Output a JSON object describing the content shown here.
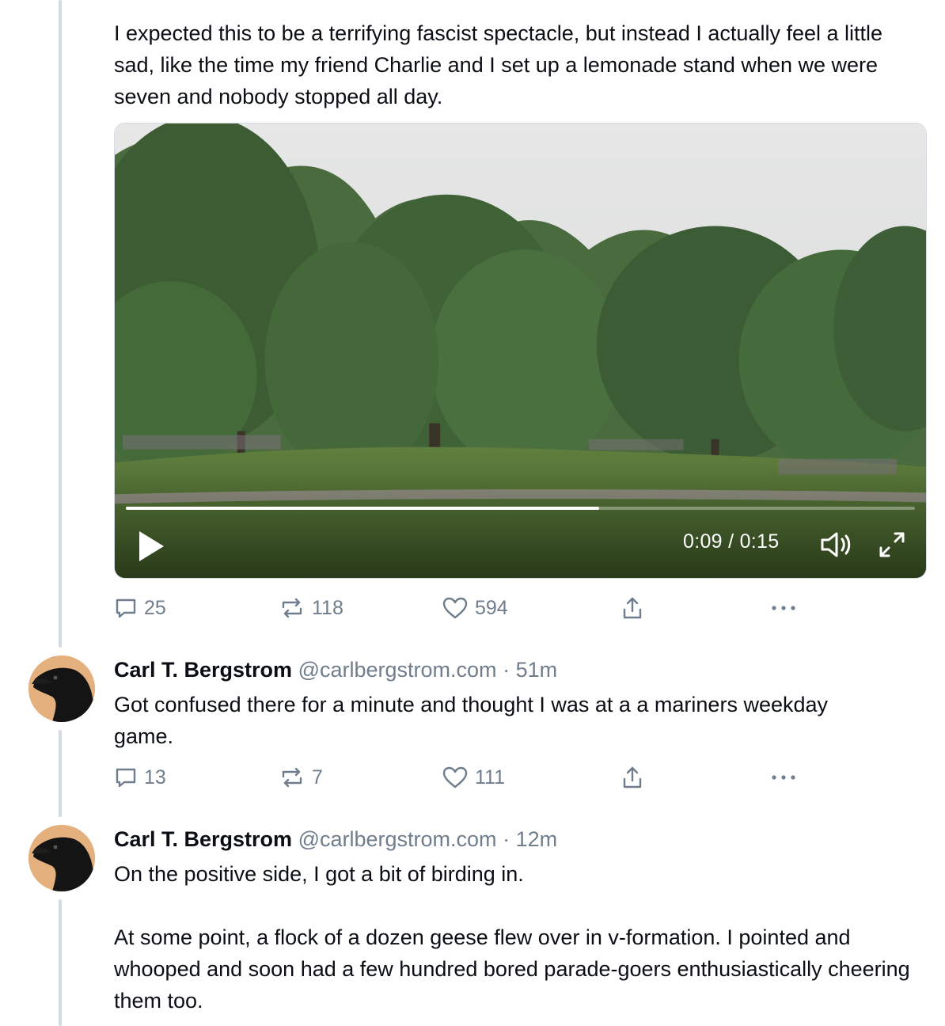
{
  "post1": {
    "text": "I expected this to be a terrifying fascist spectacle, but instead I actually feel a little sad, like the time my friend Charlie and I set up a lemonade stand when we were seven and nobody stopped all day.",
    "video": {
      "time_display": "0:09 / 0:15",
      "progress_fraction": 0.6,
      "play_icon": "play-icon",
      "volume_icon": "volume-icon",
      "fullscreen_icon": "expand-icon"
    },
    "actions": {
      "replies": "25",
      "reposts": "118",
      "likes": "594"
    }
  },
  "post2": {
    "author_name": "Carl T. Bergstrom",
    "author_handle": "@carlbergstrom.com",
    "separator": "·",
    "time_ago": "51m",
    "text": "Got confused there for a minute and thought I was at a a mariners weekday game.",
    "actions": {
      "replies": "13",
      "reposts": "7",
      "likes": "111"
    }
  },
  "post3": {
    "author_name": "Carl T. Bergstrom",
    "author_handle": "@carlbergstrom.com",
    "separator": "·",
    "time_ago": "12m",
    "text": "On the positive side, I got a bit of birding in.\n\nAt some point, a flock of a dozen geese flew over in v-formation. I pointed and whooped and soon had a few hundred bored parade-goers enthusiastically cheering them too."
  },
  "colors": {
    "text": "#0b0f14",
    "muted": "#6f7d8c",
    "thread_line": "#d4dbe2",
    "avatar_bg": "#e4b07d"
  }
}
